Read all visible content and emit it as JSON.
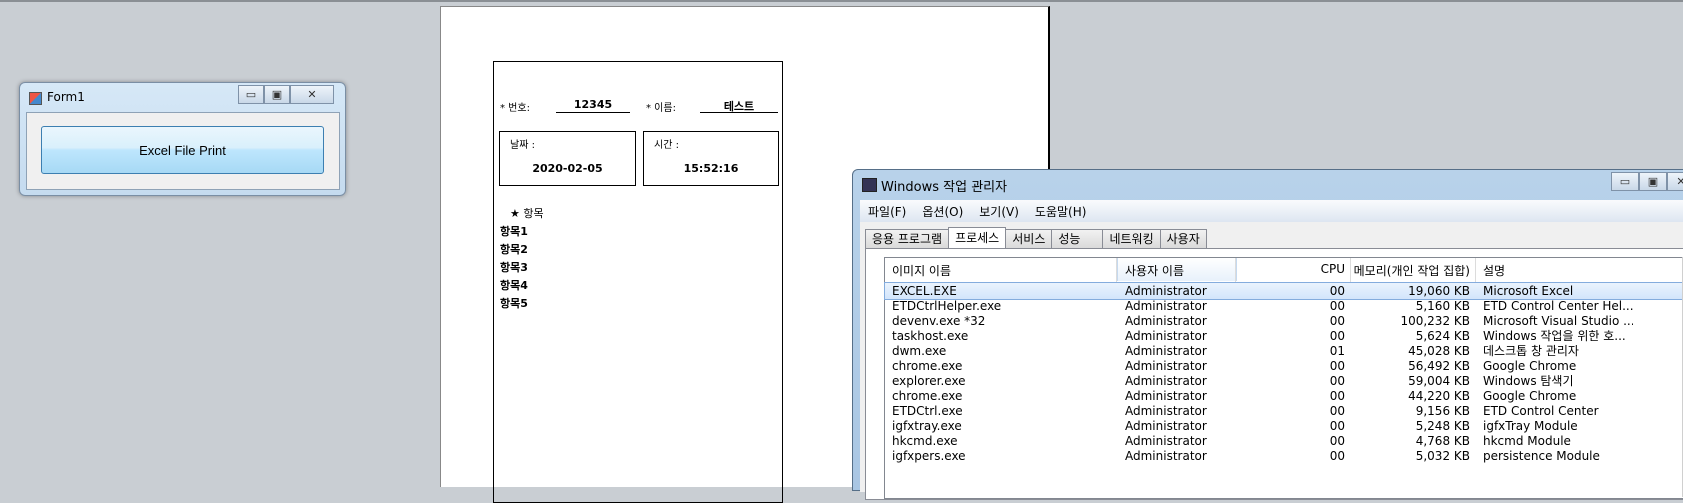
{
  "form1": {
    "title": "Form1",
    "minimize": "▭",
    "maximize": "▣",
    "close": "✕",
    "print_button": "Excel File Print"
  },
  "document": {
    "number_label": "* 번호:",
    "number_value": "12345",
    "name_label": "* 이름:",
    "name_value": "테스트",
    "date_label": "날짜 :",
    "date_value": "2020-02-05",
    "time_label": "시간 :",
    "time_value": "15:52:16",
    "items_header": "★ 항목",
    "items": [
      "항목1",
      "항목2",
      "항목3",
      "항목4",
      "항목5"
    ]
  },
  "task_manager": {
    "title": "Windows 작업 관리자",
    "menus": [
      "파일(F)",
      "옵션(O)",
      "보기(V)",
      "도움말(H)"
    ],
    "tabs": [
      "응용 프로그램",
      "프로세스",
      "서비스",
      "성능",
      "네트워킹",
      "사용자"
    ],
    "active_tab": "프로세스",
    "columns": [
      "이미지 이름",
      "사용자 이름",
      "CPU",
      "메모리(개인 작업 집합)",
      "설명"
    ],
    "rows": [
      [
        "EXCEL.EXE",
        "Administrator",
        "00",
        "19,060 KB",
        "Microsoft Excel"
      ],
      [
        "ETDCtrlHelper.exe",
        "Administrator",
        "00",
        "5,160 KB",
        "ETD Control Center Hel..."
      ],
      [
        "devenv.exe *32",
        "Administrator",
        "00",
        "100,232 KB",
        "Microsoft Visual Studio ..."
      ],
      [
        "taskhost.exe",
        "Administrator",
        "00",
        "5,624 KB",
        "Windows 작업을 위한 호..."
      ],
      [
        "dwm.exe",
        "Administrator",
        "01",
        "45,028 KB",
        "데스크톱 창 관리자"
      ],
      [
        "chrome.exe",
        "Administrator",
        "00",
        "56,492 KB",
        "Google Chrome"
      ],
      [
        "explorer.exe",
        "Administrator",
        "00",
        "59,004 KB",
        "Windows 탐색기"
      ],
      [
        "chrome.exe",
        "Administrator",
        "00",
        "44,220 KB",
        "Google Chrome"
      ],
      [
        "ETDCtrl.exe",
        "Administrator",
        "00",
        "9,156 KB",
        "ETD Control Center"
      ],
      [
        "igfxtray.exe",
        "Administrator",
        "00",
        "5,248 KB",
        "igfxTray Module"
      ],
      [
        "hkcmd.exe",
        "Administrator",
        "00",
        "4,768 KB",
        "hkcmd Module"
      ],
      [
        "igfxpers.exe",
        "Administrator",
        "00",
        "5,032 KB",
        "persistence Module"
      ]
    ]
  }
}
